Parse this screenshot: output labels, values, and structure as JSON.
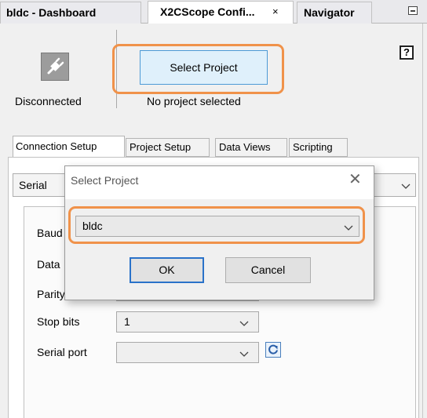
{
  "doc_tabs": {
    "dashboard": "bldc - Dashboard",
    "x2cscope": "X2CScope Confi...",
    "x2cscope_close": "×",
    "navigator": "Navigator"
  },
  "top_panel": {
    "connection_status": "Disconnected",
    "select_project_label": "Select Project",
    "project_status": "No project selected",
    "help_label": "?"
  },
  "inner_tabs": [
    "Connection Setup",
    "Project Setup",
    "Data Views",
    "Scripting"
  ],
  "connection": {
    "type": "Serial"
  },
  "settings": {
    "baud_label": "Baud",
    "data_label": "Data",
    "parity_label": "Parity",
    "stop_bits_label": "Stop bits",
    "stop_bits_value": "1",
    "serial_port_label": "Serial port",
    "serial_port_value": ""
  },
  "dialog": {
    "title": "Select Project",
    "close": "✕",
    "project_value": "bldc",
    "ok_label": "OK",
    "cancel_label": "Cancel"
  },
  "colors": {
    "highlight": "#f0924a",
    "accent": "#2a72c9",
    "select_button_bg": "#dff0fb"
  }
}
